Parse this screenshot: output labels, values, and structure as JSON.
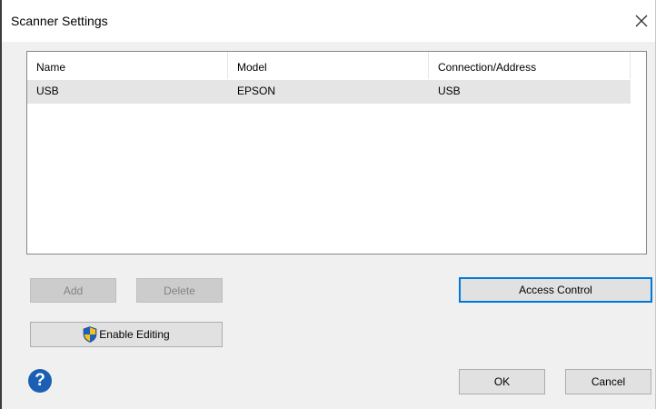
{
  "window": {
    "title": "Scanner Settings",
    "close_glyph": "✕"
  },
  "list": {
    "columns": [
      "Name",
      "Model",
      "Connection/Address"
    ],
    "rows": [
      [
        "USB",
        "EPSON",
        "USB"
      ]
    ]
  },
  "buttons": {
    "add": "Add",
    "delete": "Delete",
    "access_control": "Access Control",
    "enable_editing": "Enable Editing",
    "ok": "OK",
    "cancel": "Cancel"
  },
  "icons": {
    "help": "?",
    "shield": "uac-shield-icon"
  },
  "colors": {
    "focus_border": "#0078d7",
    "selected_row": "#e5e5e5",
    "help_icon": "#1a5fb4"
  }
}
